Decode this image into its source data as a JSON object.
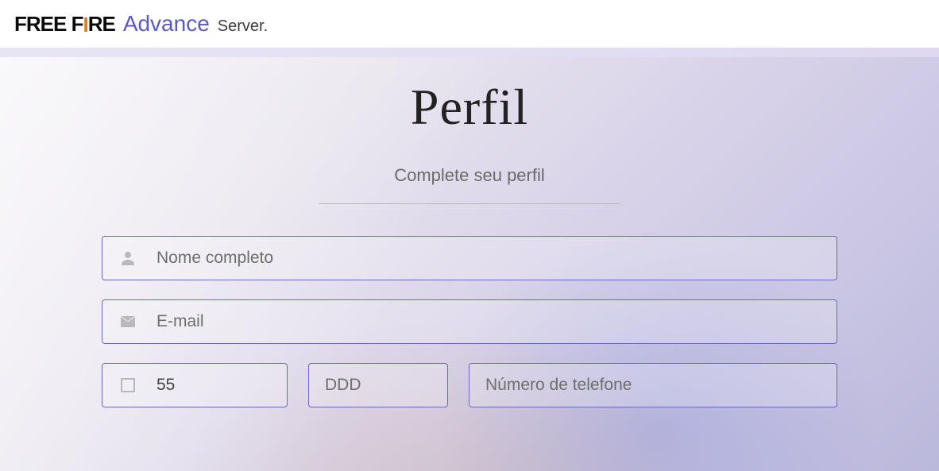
{
  "brand": {
    "free_part1": "FREE F",
    "free_accent": "I",
    "free_part2": "RE",
    "advance": "Advance",
    "server": "Server."
  },
  "page": {
    "title": "Perfil",
    "subtitle": "Complete seu perfil"
  },
  "form": {
    "name_placeholder": "Nome completo",
    "email_placeholder": "E-mail",
    "country_code_value": "55",
    "ddd_placeholder": "DDD",
    "phone_placeholder": "Número de telefone"
  }
}
